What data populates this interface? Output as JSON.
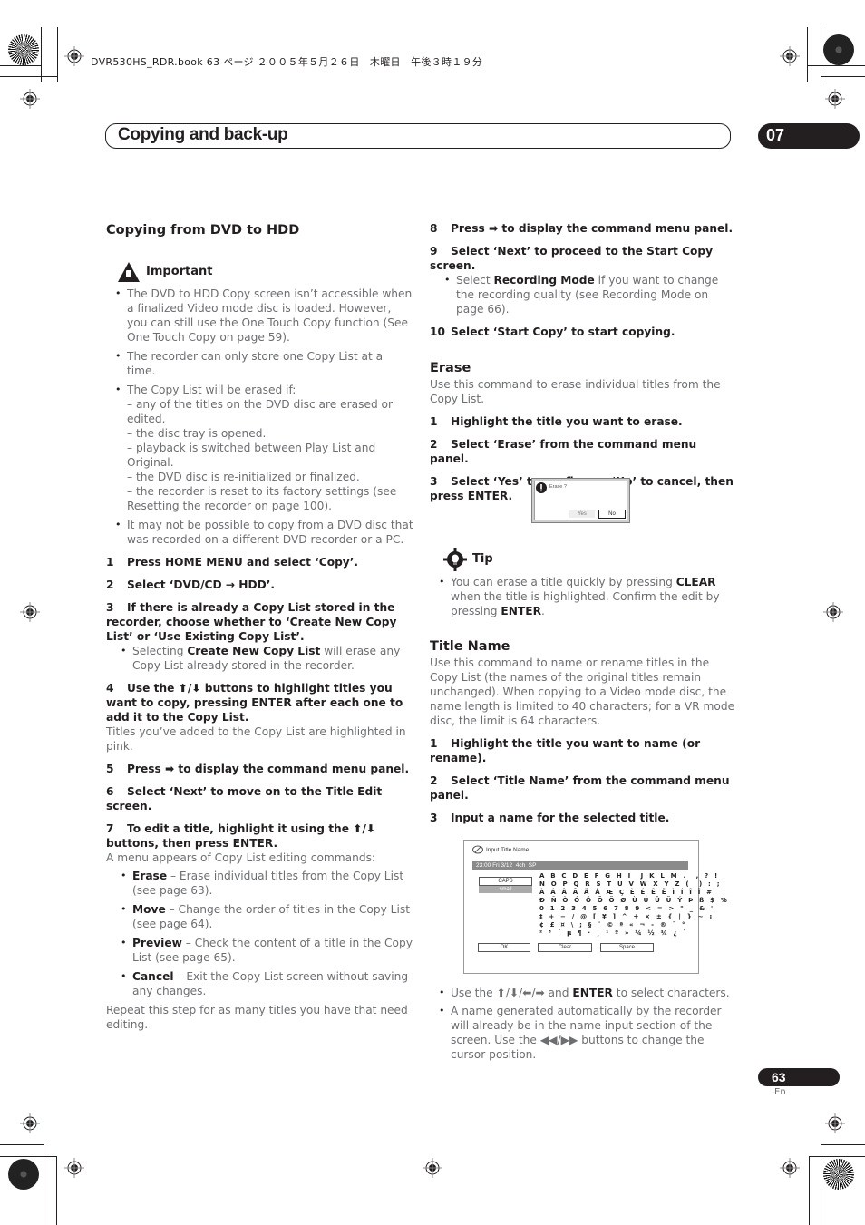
{
  "print_header": {
    "book_line": "DVR530HS_RDR.book  63 ページ  ２００５年５月２６日　木曜日　午後３時１９分"
  },
  "chapter": {
    "title": "Copying and back-up",
    "number": "07"
  },
  "left_column": {
    "section_title": "Copying from DVD to HDD",
    "important": {
      "icon": "warning-hand-icon",
      "label": "Important",
      "bullets": [
        "The DVD to HDD Copy screen isn’t accessible when a finalized Video mode disc is loaded. However, you can still use the One Touch Copy function (See One Touch Copy on page 59).",
        "The recorder can only store one Copy List at a time.",
        "The Copy List will be erased if:",
        "It may not be possible to copy from a DVD disc that was recorded on a different DVD recorder or a PC."
      ],
      "erase_conditions": [
        "– any of the titles on the DVD disc are erased or edited.",
        "– the disc tray is opened.",
        "– playback is switched between Play List and Original.",
        "– the DVD disc is re-initialized or finalized.",
        "– the recorder is reset to its factory settings (see Resetting the recorder on page 100)."
      ]
    },
    "steps": [
      {
        "num": "1",
        "text": "Press HOME MENU and select ‘Copy’."
      },
      {
        "num": "2",
        "text": "Select ‘DVD/CD → HDD’."
      },
      {
        "num": "3",
        "text": "If there is already a Copy List stored in the recorder, choose whether to ‘Create New Copy List’ or ‘Use Existing Copy List’.",
        "bullet_bold": "Create New Copy List",
        "bullet_pre": "Selecting ",
        "bullet_post": " will erase any Copy List already stored in the recorder."
      },
      {
        "num": "4",
        "text": "Use the ⬆/⬇ buttons to highlight titles you want to copy, pressing ENTER after each one to add it to the Copy List.",
        "note": "Titles you’ve added to the Copy List are highlighted in pink."
      },
      {
        "num": "5",
        "text": "Press ➡ to display the command menu panel."
      },
      {
        "num": "6",
        "text": "Select ‘Next’ to move on to the Title Edit screen."
      },
      {
        "num": "7",
        "text": "To edit a title, highlight it using the ⬆/⬇ buttons, then press ENTER.",
        "note": "A menu appears of Copy List editing commands:",
        "commands": [
          {
            "name": "Erase",
            "desc": " – Erase individual titles from the Copy List (see page 63)."
          },
          {
            "name": "Move",
            "desc": " – Change the order of titles in the Copy List (see page 64)."
          },
          {
            "name": "Preview",
            "desc": " – Check the content of a title in the Copy List (see page 65)."
          },
          {
            "name": "Cancel",
            "desc": " – Exit the Copy List screen without saving any changes."
          }
        ],
        "footer": "Repeat this step for as many titles you have that need editing."
      }
    ]
  },
  "right_column": {
    "steps_cont": [
      {
        "num": "8",
        "text": "Press ➡ to display the command menu panel."
      },
      {
        "num": "9",
        "text": "Select ‘Next’ to proceed to the Start Copy screen.",
        "bullet_pre": "Select ",
        "bullet_bold": "Recording Mode",
        "bullet_post": " if you want to change the recording quality (see Recording Mode on page 66)."
      },
      {
        "num": "10",
        "text": "Select ‘Start Copy’ to start copying."
      }
    ],
    "erase": {
      "title": "Erase",
      "intro": "Use this command to erase individual titles from the Copy List.",
      "steps": [
        {
          "num": "1",
          "text": "Highlight the title you want to erase."
        },
        {
          "num": "2",
          "text": "Select ‘Erase’ from the command menu panel."
        },
        {
          "num": "3",
          "text": "Select ‘Yes’ to confirm or ‘No’ to cancel, then press ENTER."
        }
      ],
      "dialog": {
        "prompt": "Erase ?",
        "yes": "Yes",
        "no": "No",
        "selected": "No"
      }
    },
    "tip": {
      "label": "Tip",
      "pre": "You can erase a title quickly by pressing ",
      "bold1": "CLEAR",
      "mid": " when the title is highlighted. Confirm the edit by pressing ",
      "bold2": "ENTER",
      "post": "."
    },
    "title_name": {
      "title": "Title Name",
      "intro": "Use this command to name or rename titles in the Copy List (the names of the original titles remain unchanged). When copying to a Video mode disc, the name length is limited to 40 characters; for a VR mode disc, the limit is 64 characters.",
      "steps": [
        {
          "num": "1",
          "text": "Highlight the title you want to name (or rename)."
        },
        {
          "num": "2",
          "text": "Select ‘Title Name’ from the command menu panel."
        },
        {
          "num": "3",
          "text": "Input a name for the selected title."
        }
      ],
      "screen": {
        "heading": "Input Title Name",
        "name_value": "23:00 Fri 3/12  4ch  SP",
        "case_options": [
          "CAPS",
          "small"
        ],
        "selected_case": "CAPS",
        "char_rows": [
          "A B C D E F G H I  J K L M .  , ? !",
          "N O P Q R S T U V W X Y Z (  ) : ;",
          "À Á Â Ã Ä Å Æ Ç È É Ê Ë Ì Í Î Ï #",
          "Ð Ñ Ò Ó Ô Õ Ö Ø Ù Ú Û Ü Ý Þ ß $ %",
          "0 1 2 3 4 5 6 7 8 9 < = > \" _ & '",
          "‡ + − / @ [ ¥ ] ^ ÷ × ± { | } ~ ¡",
          "¢ £ ¤ \\ ; § ¨ © ª « ¬ - ® ¯ °",
          "² ³ ´ µ ¶ · ¸ ¹ º » ¼ ½ ¾ ¿ `"
        ],
        "buttons": [
          "OK",
          "Clear",
          "Space"
        ]
      },
      "bullets": [
        {
          "pre": "Use the ⬆/⬇/⬅/➡ and ",
          "bold": "ENTER",
          "post": " to select characters."
        },
        {
          "pre": "A name generated automatically by the recorder will already be in the name input section of the screen. Use the ◀◀/▶▶ buttons to change the cursor position.",
          "bold": "",
          "post": ""
        }
      ]
    }
  },
  "footer": {
    "page_number": "63",
    "language": "En"
  }
}
